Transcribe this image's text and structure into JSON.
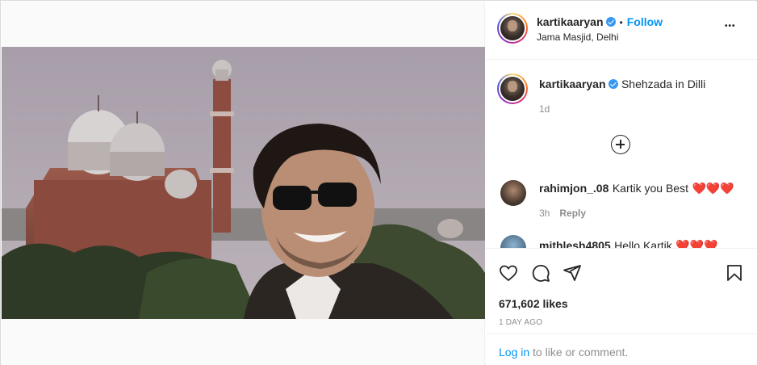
{
  "post": {
    "username": "kartikaaryan",
    "follow_label": "Follow",
    "separator": "•",
    "location": "Jama Masjid, Delhi",
    "more_label": "•••"
  },
  "caption": {
    "username": "kartikaaryan",
    "text": "Shehzada in Dilli",
    "time": "1d"
  },
  "comments": [
    {
      "username": "rahimjon_.08",
      "text": "Kartik you Best",
      "hearts": "❤️❤️❤️",
      "time": "3h",
      "reply_label": "Reply"
    },
    {
      "username": "mithlesh4805",
      "text": "Hello Kartik",
      "hearts": "❤️❤️❤️"
    }
  ],
  "stats": {
    "likes": "671,602 likes",
    "posted": "1 DAY AGO"
  },
  "footer": {
    "login_link": "Log in",
    "login_rest": " to like or comment."
  },
  "icons": {
    "verified": "verified-badge-icon",
    "more": "more-options-icon",
    "load_more": "add-circle-icon",
    "like": "heart-icon",
    "comment": "comment-icon",
    "share": "share-icon",
    "save": "bookmark-icon"
  },
  "colors": {
    "accent": "#0095f6",
    "verified": "#3897f0",
    "text": "#262626",
    "muted": "#8e8e8e",
    "heart": "#e0245e"
  }
}
